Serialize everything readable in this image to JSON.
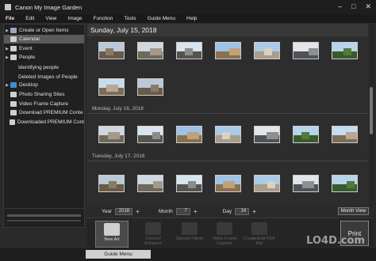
{
  "window": {
    "title": "Canon My Image Garden",
    "controls": [
      "–",
      "□",
      "✕"
    ]
  },
  "menu": [
    "File",
    "Edit",
    "View",
    "Image",
    "Function",
    "Tools",
    "Guide Menu",
    "Help"
  ],
  "sidebar": {
    "items": [
      {
        "label": "Create or Open Items",
        "arrow": "▶",
        "icon_color": "#9aa8b8"
      },
      {
        "label": "Calendar",
        "arrow": "",
        "icon_color": "#d0d0d0"
      },
      {
        "label": "Event",
        "arrow": "▶",
        "icon_color": "#d0d0d0"
      },
      {
        "label": "People",
        "arrow": "▶",
        "icon_color": "#d0d0d0"
      },
      {
        "label": "Identifying people",
        "arrow": "",
        "icon_color": ""
      },
      {
        "label": "Deleted Images of People",
        "arrow": "",
        "icon_color": ""
      },
      {
        "label": "Desktop",
        "arrow": "▶",
        "icon_color": "#3b8ed8"
      },
      {
        "label": "Photo Sharing Sites",
        "arrow": "",
        "icon_color": "#d0d0d0"
      },
      {
        "label": "Video Frame Capture",
        "arrow": "",
        "icon_color": "#d0d0d0"
      },
      {
        "label": "Download PREMIUM Conte",
        "arrow": "",
        "icon_color": "#d0d0d0"
      },
      {
        "label": "Downloaded PREMIUM Cont",
        "arrow": "",
        "icon_color": "#d0d0d0"
      }
    ]
  },
  "main": {
    "date_header": "Sunday, July 15, 2018",
    "date_labels": [
      "Monday, July 16, 2018",
      "Tuesday, July 17, 2018"
    ]
  },
  "controls": {
    "year_label": "Year",
    "year_value": "2018",
    "month_label": "Month",
    "month_value": "7",
    "day_label": "Day",
    "day_value": "14",
    "month_view": "Month View"
  },
  "toolbar": {
    "tools": [
      {
        "label": "New Art",
        "state": "active"
      },
      {
        "label": "Correct/ Enhance",
        "state": "disabled"
      },
      {
        "label": "Special Filters",
        "state": "disabled"
      },
      {
        "label": "Video Frame Capture",
        "state": "disabled"
      },
      {
        "label": "Create/Edit PDF File",
        "state": "disabled"
      }
    ],
    "print": "Print"
  },
  "bottom": {
    "guide_menu": "Guide Menu"
  },
  "watermark": "LO4D.com"
}
